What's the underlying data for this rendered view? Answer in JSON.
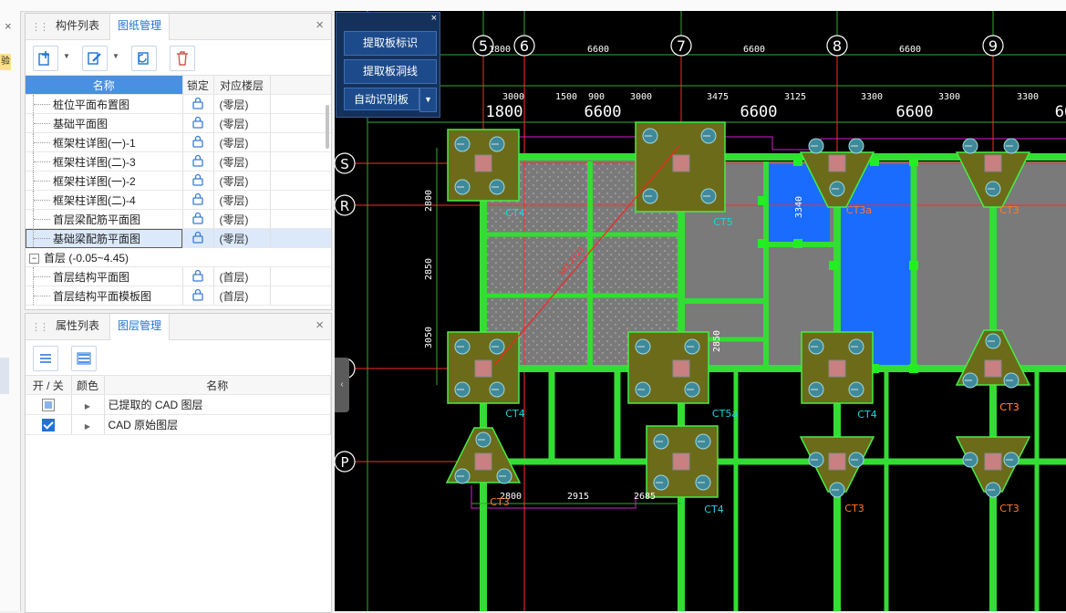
{
  "drawing_panel": {
    "tabs": [
      "构件列表",
      "图纸管理"
    ],
    "active_tab": 1,
    "close_label": "×",
    "columns": [
      "名称",
      "锁定",
      "对应楼层"
    ],
    "rows": [
      {
        "name": "桩位平面布置图",
        "floor": "(零层)"
      },
      {
        "name": "基础平面图",
        "floor": "(零层)"
      },
      {
        "name": "框架柱详图(一)-1",
        "floor": "(零层)"
      },
      {
        "name": "框架柱详图(二)-3",
        "floor": "(零层)"
      },
      {
        "name": "框架柱详图(一)-2",
        "floor": "(零层)"
      },
      {
        "name": "框架柱详图(二)-4",
        "floor": "(零层)"
      },
      {
        "name": "首层梁配筋平面图",
        "floor": "(零层)"
      },
      {
        "name": "基础梁配筋平面图",
        "floor": "(零层)",
        "selected": true
      }
    ],
    "group": {
      "sign": "−",
      "label": "首层 (-0.05~4.45)"
    },
    "group_rows": [
      {
        "name": "首层结构平面图",
        "floor": "(首层)"
      },
      {
        "name": "首层结构平面模板图",
        "floor": "(首层)"
      }
    ]
  },
  "layer_panel": {
    "tabs": [
      "属性列表",
      "图层管理"
    ],
    "active_tab": 1,
    "close_label": "×",
    "columns": [
      "开 / 关",
      "颜色",
      "名称"
    ],
    "rows": [
      {
        "name": "已提取的 CAD 图层",
        "state": "partial"
      },
      {
        "name": "CAD 原始图层",
        "state": "checked"
      }
    ]
  },
  "float_toolbar": {
    "close_label": "×",
    "buttons": [
      "提取板标识",
      "提取板洞线",
      "自动识别板"
    ]
  },
  "cad": {
    "axis_labels": [
      "5",
      "6",
      "7",
      "8",
      "9"
    ],
    "row_labels": [
      "S",
      "R",
      "P"
    ],
    "top_dims_1": [
      "1800",
      "6600",
      "6600",
      "6600"
    ],
    "top_dims_2": [
      "3000",
      "1500",
      "900",
      "3000",
      "3475",
      "3125",
      "3300",
      "3300",
      "3300"
    ],
    "top_dims_3": [
      "1800",
      "6600",
      "6600",
      "6600",
      "66"
    ],
    "vert_dims": [
      "2800",
      "2850",
      "3050",
      "3340",
      "2850"
    ],
    "bottom_dims": [
      "2800",
      "2915",
      "2685"
    ],
    "cap_labels": [
      "CT4",
      "CT5",
      "CT3a",
      "CT3",
      "CT4",
      "CT5a",
      "CT4",
      "CT3",
      "CT3",
      "CT4",
      "CT3",
      "CT3",
      "CT3"
    ],
    "diag_label": "WKL2(2)",
    "colors": {
      "beam": "#33dd33",
      "slab_blue": "#1a6cff",
      "cap": "#6b6b1a",
      "grid": "#ff2a2a",
      "cyan": "#22d3e0"
    }
  }
}
